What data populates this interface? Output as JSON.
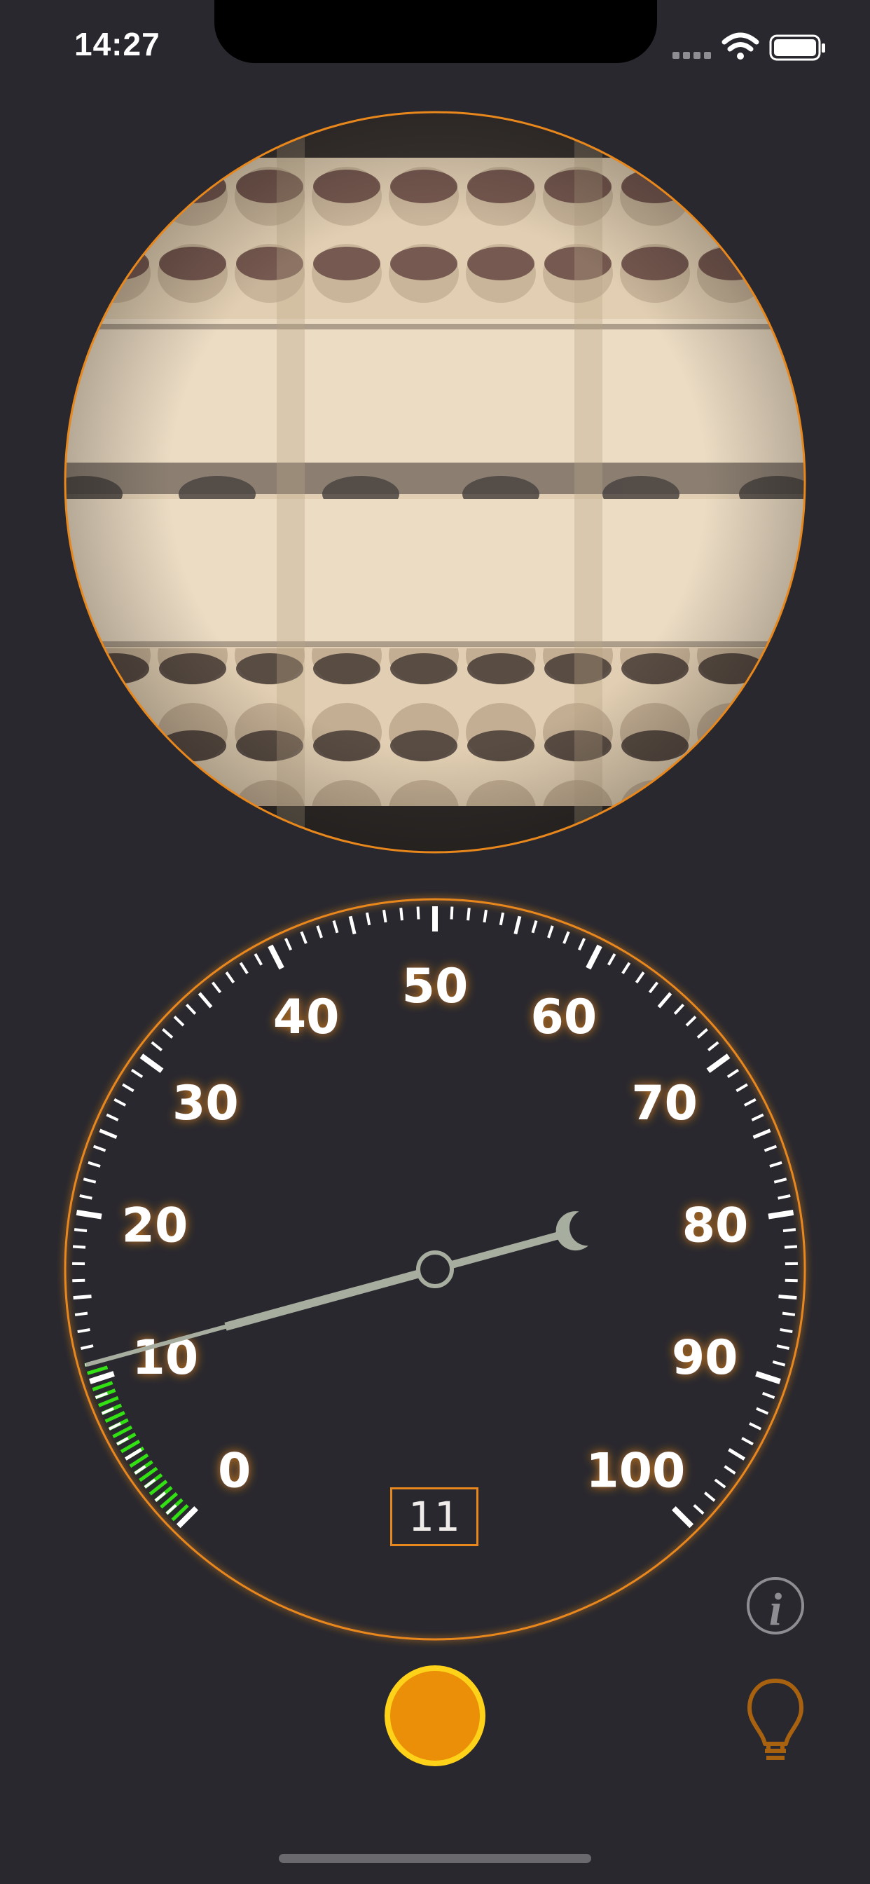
{
  "status_bar": {
    "time": "14:27",
    "icons": [
      "signal-dots-icon",
      "wifi-icon",
      "battery-icon"
    ]
  },
  "camera_view": {
    "description_icon": "camera-lens-preview",
    "border_color": "#e8871b"
  },
  "gauge": {
    "tick_labels": [
      "0",
      "10",
      "20",
      "30",
      "40",
      "50",
      "60",
      "70",
      "80",
      "90",
      "100"
    ],
    "min": 0,
    "max": 100,
    "needle_value": 11,
    "green_zone": [
      0,
      11
    ],
    "readout": "11",
    "accent_color": "#e8871b",
    "zone_color": "#33e014",
    "needle_color": "#a7aea0"
  },
  "controls": {
    "capture_button_color": "#ea8f07",
    "info_icon": "info-icon",
    "light_icon": "lightbulb-icon"
  }
}
